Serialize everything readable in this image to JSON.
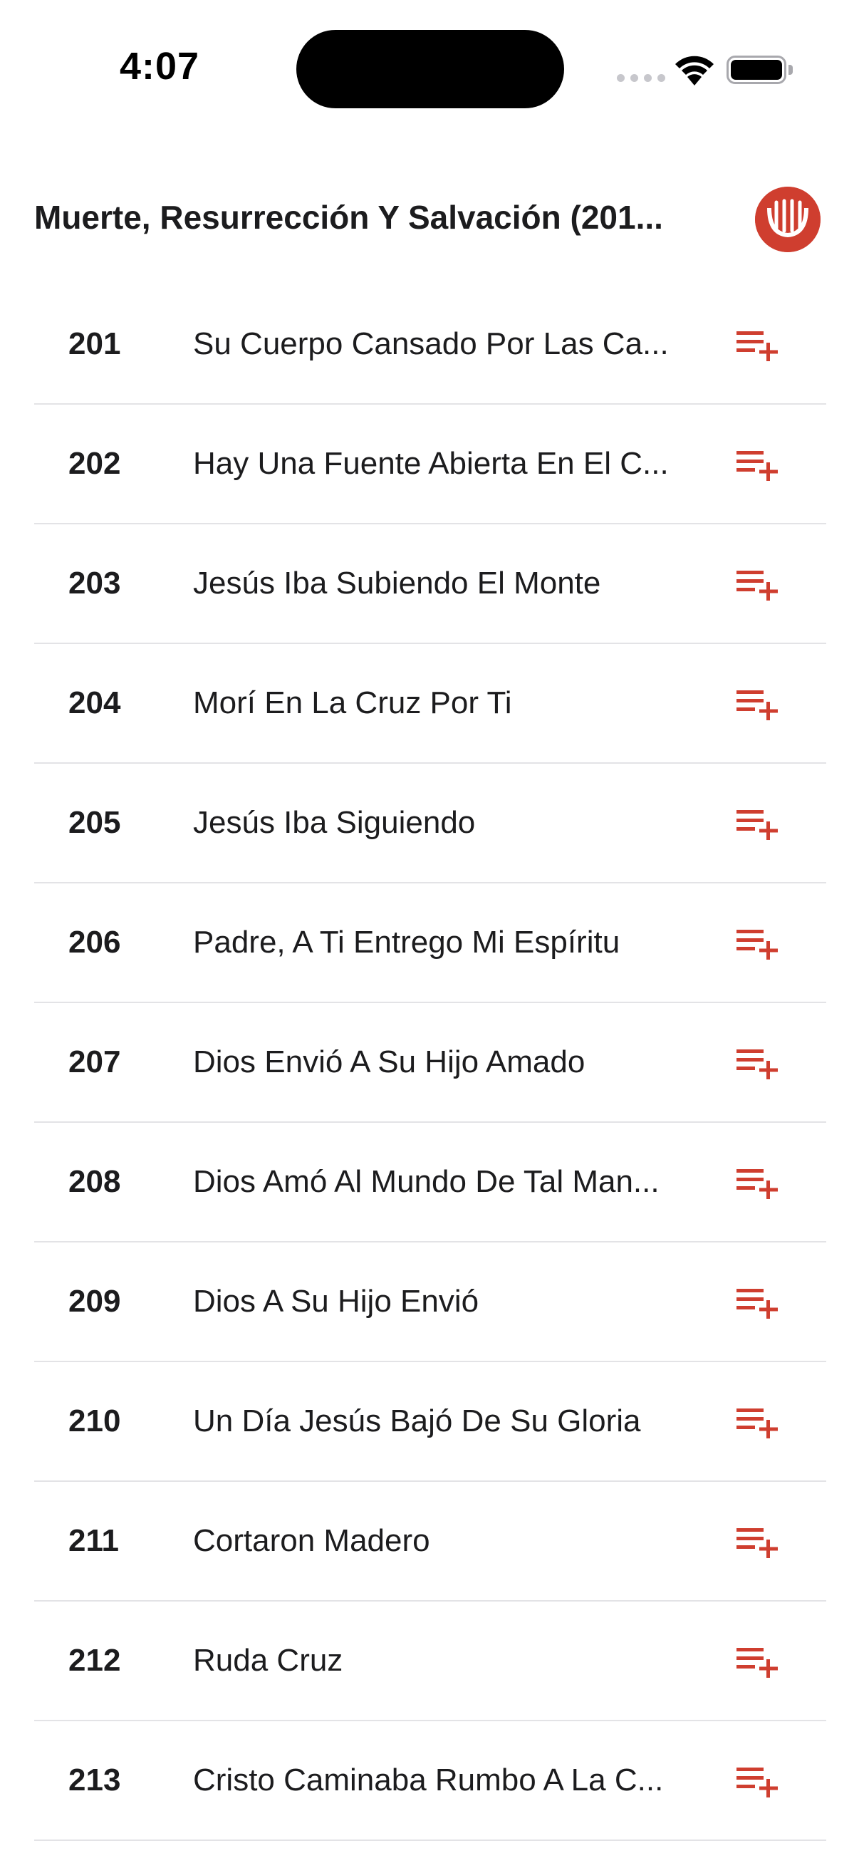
{
  "status_bar": {
    "time": "4:07"
  },
  "header": {
    "title": "Muerte, Resurrección Y Salvación (201...",
    "logo_icon": "hymnal-logo-icon"
  },
  "colors": {
    "accent": "#cf3e2f",
    "text": "#1c1c1e",
    "divider": "#e3e3e6"
  },
  "hymns": [
    {
      "number": "201",
      "title": "Su Cuerpo Cansado Por Las Ca..."
    },
    {
      "number": "202",
      "title": "Hay Una Fuente Abierta En El C..."
    },
    {
      "number": "203",
      "title": "Jesús Iba Subiendo El Monte"
    },
    {
      "number": "204",
      "title": "Morí En La Cruz Por Ti"
    },
    {
      "number": "205",
      "title": "Jesús Iba Siguiendo"
    },
    {
      "number": "206",
      "title": "Padre, A Ti Entrego Mi Espíritu"
    },
    {
      "number": "207",
      "title": "Dios Envió A Su Hijo Amado"
    },
    {
      "number": "208",
      "title": "Dios Amó Al Mundo De Tal Man..."
    },
    {
      "number": "209",
      "title": "Dios A Su Hijo Envió"
    },
    {
      "number": "210",
      "title": "Un Día Jesús Bajó De Su Gloria"
    },
    {
      "number": "211",
      "title": "Cortaron Madero"
    },
    {
      "number": "212",
      "title": "Ruda Cruz"
    },
    {
      "number": "213",
      "title": "Cristo Caminaba Rumbo A La C..."
    }
  ],
  "row_action_icon": "playlist-add-icon"
}
